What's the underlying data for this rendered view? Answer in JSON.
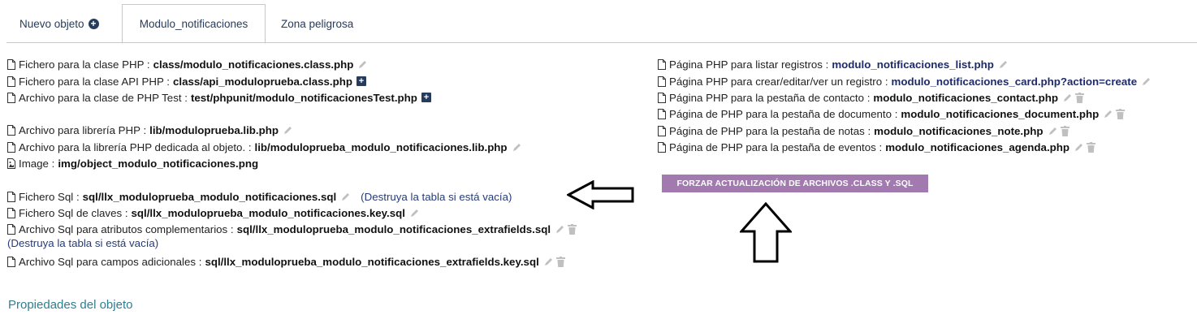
{
  "tabs": {
    "new_object": "Nuevo objeto",
    "module": "Modulo_notificaciones",
    "danger": "Zona peligrosa"
  },
  "left": [
    {
      "label": "Fichero para la clase PHP :",
      "value": "class/modulo_notificaciones.class.php"
    },
    {
      "label": "Fichero para la clase API PHP :",
      "value": "class/api_moduloprueba.class.php"
    },
    {
      "label": "Archivo para la clase de PHP Test :",
      "value": "test/phpunit/modulo_notificacionesTest.php"
    },
    {
      "label": "Archivo para librería PHP :",
      "value": "lib/moduloprueba.lib.php"
    },
    {
      "label": "Archivo para la librería PHP dedicada al objeto. :",
      "value": "lib/moduloprueba_modulo_notificaciones.lib.php"
    },
    {
      "label": "Image :",
      "value": "img/object_modulo_notificaciones.png"
    },
    {
      "label": "Fichero Sql :",
      "value": "sql/llx_moduloprueba_modulo_notificaciones.sql",
      "extra": "(Destruya la tabla si está vacía)"
    },
    {
      "label": "Fichero Sql de claves :",
      "value": "sql/llx_moduloprueba_modulo_notificaciones.key.sql"
    },
    {
      "label": "Archivo Sql para atributos complementarios :",
      "value": "sql/llx_moduloprueba_modulo_notificaciones_extrafields.sql",
      "extra": "(Destruya la tabla si está vacía)"
    },
    {
      "label": "Archivo Sql para campos adicionales :",
      "value": "sql/llx_moduloprueba_modulo_notificaciones_extrafields.key.sql"
    }
  ],
  "right": [
    {
      "label": "Página PHP para listar registros :",
      "value": "modulo_notificaciones_list.php"
    },
    {
      "label": "Página PHP para crear/editar/ver un registro :",
      "value": "modulo_notificaciones_card.php?action=create"
    },
    {
      "label": "Página PHP para la pestaña de contacto :",
      "value": "modulo_notificaciones_contact.php"
    },
    {
      "label": "Página de PHP para la pestaña de documento :",
      "value": "modulo_notificaciones_document.php"
    },
    {
      "label": "Página de PHP para la pestaña de notas :",
      "value": "modulo_notificaciones_note.php"
    },
    {
      "label": "Página de PHP para la pestaña de eventos :",
      "value": "modulo_notificaciones_agenda.php"
    }
  ],
  "force_button": "FORZAR ACTUALIZACIÓN DE ARCHIVOS .CLASS Y .SQL",
  "section_title": "Propiedades del objeto",
  "colors": {
    "button": "#a37ab0",
    "link": "#1d2a6b",
    "section": "#2f7f8f",
    "tab_text": "#263c5c"
  }
}
